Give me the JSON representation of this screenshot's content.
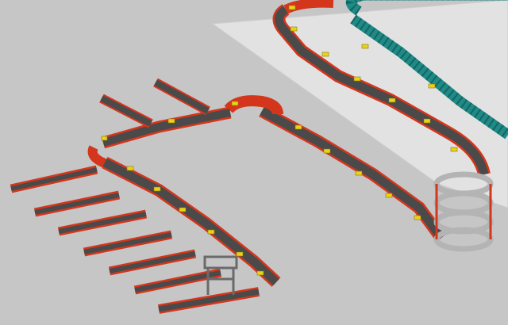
{
  "scene": {
    "name": "conveyor-sortation-system-3d-render",
    "background_color": "#c6c6c6",
    "floor_platform_color": "#e2e2e2",
    "frame_color": "#d4361c",
    "belt_color": "#4a4a4a",
    "parcel_color": "#e8d21a",
    "teal_conveyor_color": "#1f8a86",
    "spiral_color": "#b4b4b4",
    "gantry_color": "#6a6a6a"
  }
}
